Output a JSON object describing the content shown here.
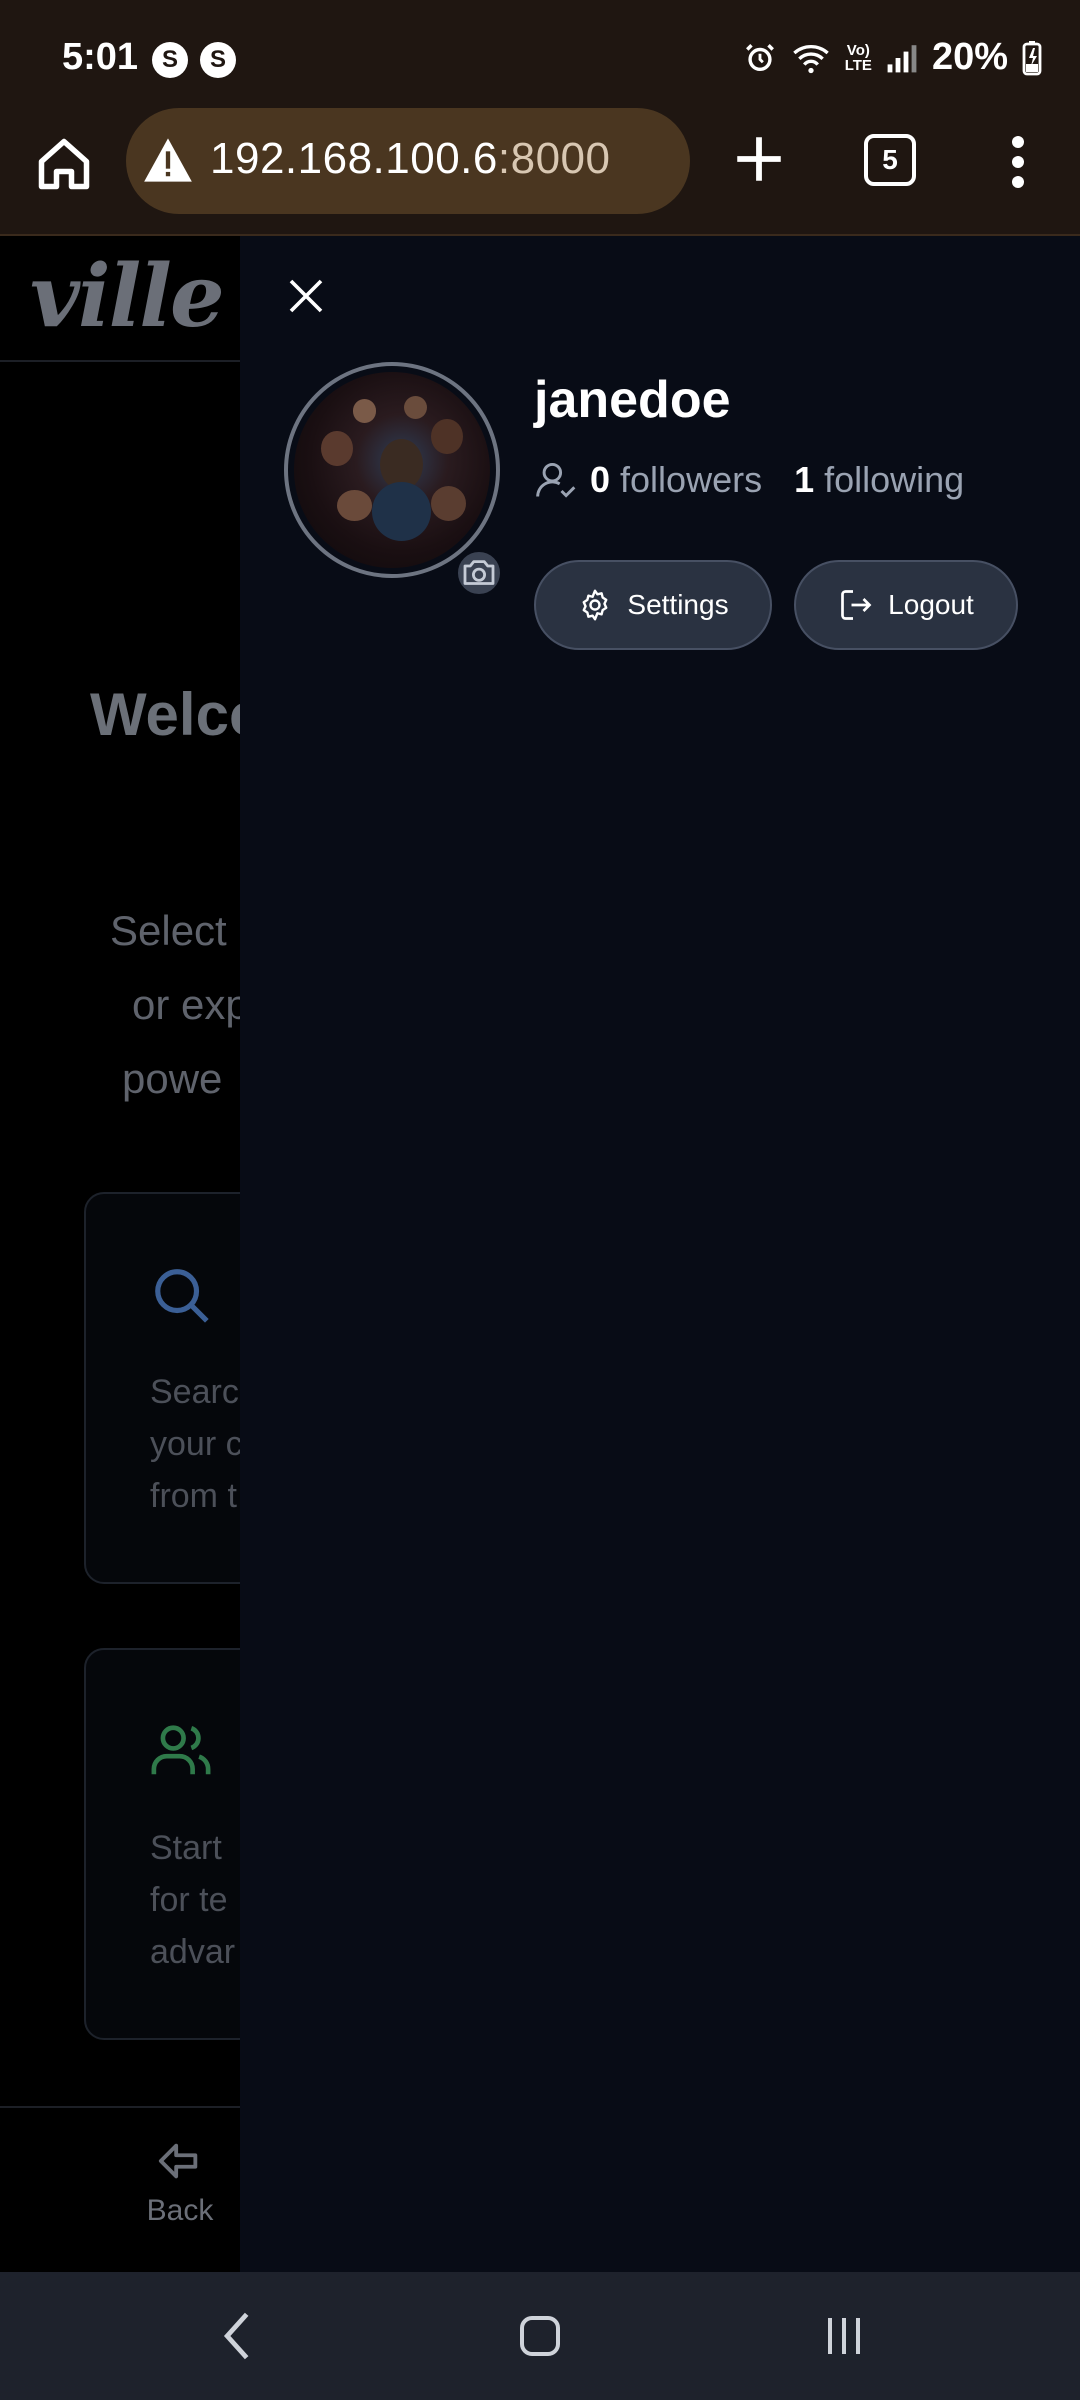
{
  "status_bar": {
    "time": "5:01",
    "notification_badges": [
      "S",
      "S"
    ],
    "volte": "Vo)\nLTE",
    "battery": "20%"
  },
  "browser": {
    "url_host": "192.168.100.6",
    "url_port": ":8000",
    "tab_count": "5",
    "icons": [
      "home-icon",
      "warning-icon",
      "plus-icon",
      "tabs-icon",
      "more-icon"
    ]
  },
  "app": {
    "logo": "ville",
    "welcome": "Welco",
    "intro_lines": [
      "Select",
      "or exp",
      "powe"
    ],
    "cards": [
      {
        "icon": "search-icon",
        "text": "Searc\nyour c\nfrom t"
      },
      {
        "icon": "users-icon",
        "text": "Start\nfor te\nadvar"
      }
    ],
    "back_label": "Back"
  },
  "drawer": {
    "username": "janedoe",
    "followers_count": "0",
    "followers_label": "followers",
    "following_count": "1",
    "following_label": "following",
    "settings_label": "Settings",
    "logout_label": "Logout"
  },
  "colors": {
    "status_bar_bg": "#1f1611",
    "url_bar_bg": "#4a3620",
    "drawer_bg": "#080c16",
    "button_bg": "#2a3241",
    "search_icon_color": "#3b5f96",
    "users_icon_color": "#2f7a4a"
  }
}
